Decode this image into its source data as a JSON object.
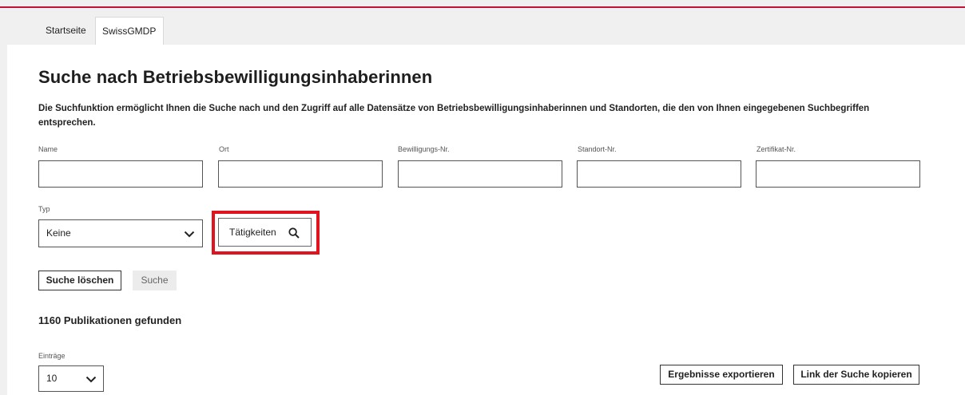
{
  "tabs": {
    "home": "Startseite",
    "active": "SwissGMDP"
  },
  "page": {
    "title": "Suche nach Betriebsbewilligungsinhaberinnen",
    "description": "Die Suchfunktion ermöglicht Ihnen die Suche nach und den Zugriff auf alle Datensätze von Betriebsbewilligungsinhaberinnen und Standorten, die den von Ihnen eingegebenen Suchbegriffen entsprechen."
  },
  "fields": {
    "name": {
      "label": "Name",
      "value": ""
    },
    "ort": {
      "label": "Ort",
      "value": ""
    },
    "bewilligung": {
      "label": "Bewilligungs-Nr.",
      "value": ""
    },
    "standort": {
      "label": "Standort-Nr.",
      "value": ""
    },
    "zertifikat": {
      "label": "Zertifikat-Nr.",
      "value": ""
    }
  },
  "typ": {
    "label": "Typ",
    "selected": "Keine"
  },
  "taetigkeiten_label": "Tätigkeiten",
  "buttons": {
    "clear": "Suche löschen",
    "search": "Suche",
    "export": "Ergebnisse exportieren",
    "copy_link": "Link der Suche kopieren"
  },
  "results": {
    "count_text": "1160 Publikationen gefunden"
  },
  "entries": {
    "label": "Einträge",
    "selected": "10"
  },
  "colors": {
    "accent": "#c0133a",
    "highlight": "#e0141e"
  }
}
